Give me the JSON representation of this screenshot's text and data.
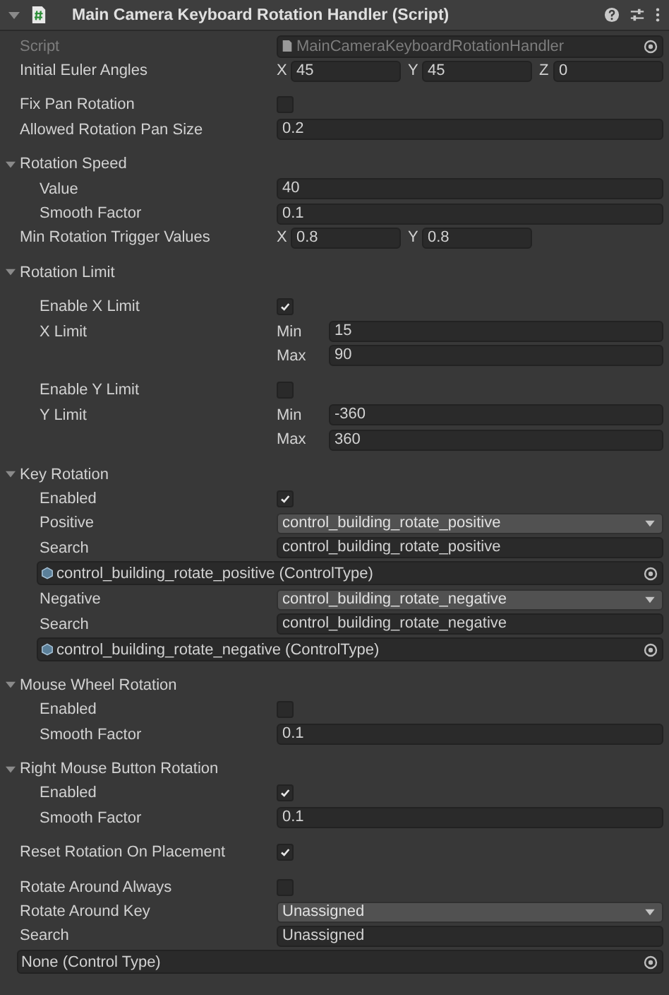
{
  "component": {
    "title": "Main Camera Keyboard Rotation Handler (Script)",
    "expanded": true
  },
  "groups": [
    [
      {
        "kind": "script",
        "label": "Script",
        "value": "MainCameraKeyboardRotationHandler"
      },
      {
        "kind": "vector",
        "label": "Initial Euler Angles",
        "components": [
          {
            "axis": "X",
            "value": "45"
          },
          {
            "axis": "Y",
            "value": "45"
          },
          {
            "axis": "Z",
            "value": "0"
          }
        ]
      }
    ],
    [
      {
        "kind": "checkbox",
        "label": "Fix Pan Rotation",
        "checked": false
      },
      {
        "kind": "field",
        "label": "Allowed Rotation Pan Size",
        "value": "0.2"
      }
    ],
    [
      {
        "kind": "foldout",
        "label": "Rotation Speed",
        "expanded": true,
        "children": [
          [
            {
              "kind": "field",
              "label": "Value",
              "value": "40"
            },
            {
              "kind": "field",
              "label": "Smooth Factor",
              "value": "0.1"
            }
          ]
        ]
      },
      {
        "kind": "vector",
        "label": "Min Rotation Trigger Values",
        "components": [
          {
            "axis": "X",
            "value": "0.8"
          },
          {
            "axis": "Y",
            "value": "0.8"
          }
        ]
      }
    ],
    [
      {
        "kind": "foldout",
        "label": "Rotation Limit",
        "expanded": true,
        "children": [
          [
            {
              "kind": "checkbox",
              "label": "Enable X Limit",
              "checked": true
            },
            {
              "kind": "range",
              "label": "X Limit",
              "min_label": "Min",
              "min": "15",
              "max_label": "Max",
              "max": "90"
            }
          ],
          [
            {
              "kind": "checkbox",
              "label": "Enable Y Limit",
              "checked": false
            },
            {
              "kind": "range",
              "label": "Y Limit",
              "min_label": "Min",
              "min": "-360",
              "max_label": "Max",
              "max": "360"
            }
          ]
        ]
      }
    ],
    [
      {
        "kind": "foldout",
        "label": "Key Rotation",
        "expanded": true,
        "children": [
          [
            {
              "kind": "checkbox",
              "label": "Enabled",
              "checked": true
            },
            {
              "kind": "dropdown",
              "label": "Positive",
              "value": "control_building_rotate_positive"
            },
            {
              "kind": "field",
              "label": "Search",
              "value": "control_building_rotate_positive"
            },
            {
              "kind": "asset",
              "value": "control_building_rotate_positive (ControlType)"
            },
            {
              "kind": "dropdown",
              "label": "Negative",
              "value": "control_building_rotate_negative"
            },
            {
              "kind": "field",
              "label": "Search",
              "value": "control_building_rotate_negative"
            },
            {
              "kind": "asset",
              "value": "control_building_rotate_negative (ControlType)"
            }
          ]
        ]
      }
    ],
    [
      {
        "kind": "foldout",
        "label": "Mouse Wheel Rotation",
        "expanded": true,
        "children": [
          [
            {
              "kind": "checkbox",
              "label": "Enabled",
              "checked": false
            },
            {
              "kind": "field",
              "label": "Smooth Factor",
              "value": "0.1"
            }
          ]
        ]
      }
    ],
    [
      {
        "kind": "foldout",
        "label": "Right Mouse Button Rotation",
        "expanded": true,
        "children": [
          [
            {
              "kind": "checkbox",
              "label": "Enabled",
              "checked": true
            },
            {
              "kind": "field",
              "label": "Smooth Factor",
              "value": "0.1"
            }
          ]
        ]
      }
    ],
    [
      {
        "kind": "checkbox",
        "label": "Reset Rotation On Placement",
        "checked": true
      }
    ],
    [
      {
        "kind": "checkbox",
        "label": "Rotate Around Always",
        "checked": false
      },
      {
        "kind": "dropdown",
        "label": "Rotate Around Key",
        "value": "Unassigned"
      },
      {
        "kind": "field",
        "label": "Search",
        "value": "Unassigned"
      },
      {
        "kind": "object",
        "value": "None (Control Type)"
      }
    ]
  ]
}
